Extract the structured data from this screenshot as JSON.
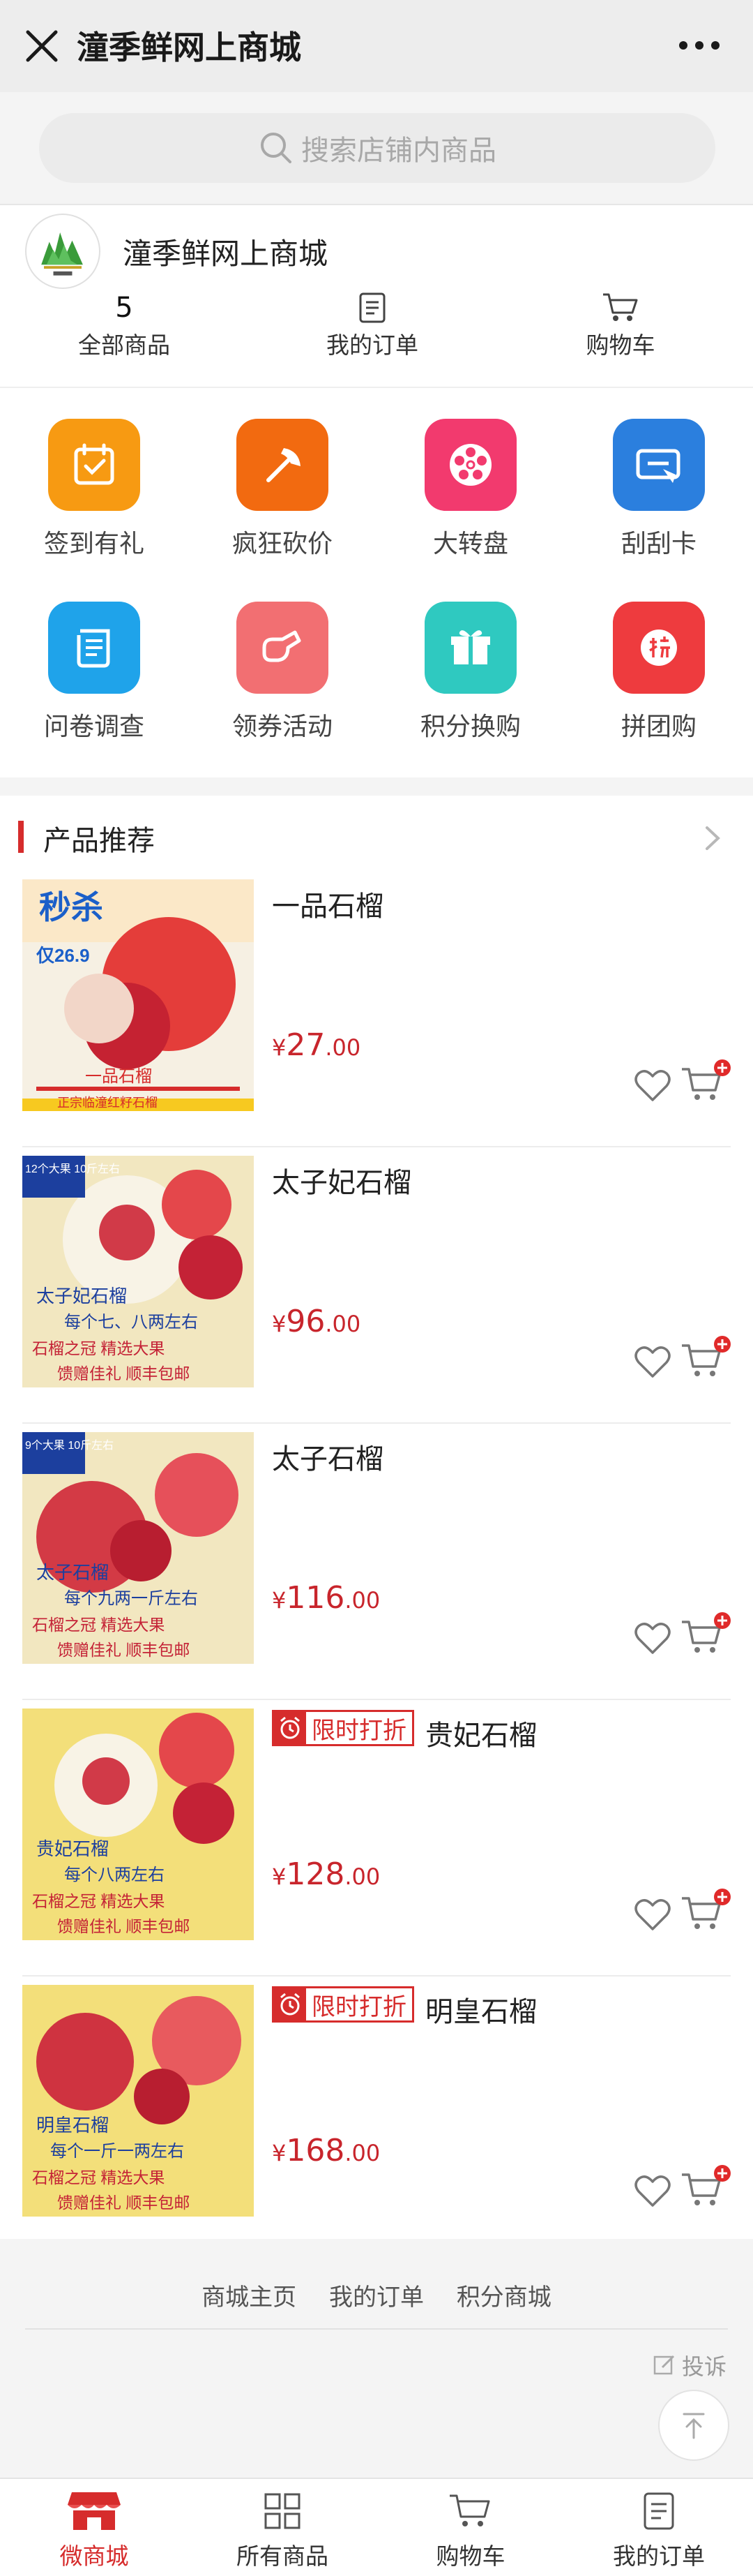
{
  "window": {
    "title": "潼季鲜网上商城",
    "close_icon": "close-icon",
    "more_icon": "more-icon"
  },
  "search": {
    "placeholder": "搜索店铺内商品"
  },
  "shop": {
    "name": "潼季鲜网上商城",
    "stats": [
      {
        "value": "5",
        "label": "全部商品"
      },
      {
        "icon": "order-icon",
        "label": "我的订单"
      },
      {
        "icon": "cart-icon",
        "label": "购物车"
      }
    ]
  },
  "menu": {
    "items": [
      {
        "label": "签到有礼",
        "icon": "calendar-check-icon",
        "color": "#f79a12"
      },
      {
        "label": "疯狂砍价",
        "icon": "axe-icon",
        "color": "#f26a10"
      },
      {
        "label": "大转盘",
        "icon": "wheel-icon",
        "color": "#f23a6e"
      },
      {
        "label": "刮刮卡",
        "icon": "scratch-card-icon",
        "color": "#2b7fde"
      },
      {
        "label": "问卷调查",
        "icon": "scroll-icon",
        "color": "#1fa3ea"
      },
      {
        "label": "领券活动",
        "icon": "coupon-hand-icon",
        "color": "#f26f72"
      },
      {
        "label": "积分换购",
        "icon": "gift-icon",
        "color": "#2fc9c0"
      },
      {
        "label": "拼团购",
        "icon": "group-buy-icon",
        "color": "#ee3b3e"
      }
    ]
  },
  "products": {
    "section_title": "产品推荐",
    "items": [
      {
        "name": "一品石榴",
        "currency": "¥",
        "price_int": "27",
        "price_dec": ".00",
        "tag": ""
      },
      {
        "name": "太子妃石榴",
        "currency": "¥",
        "price_int": "96",
        "price_dec": ".00",
        "tag": ""
      },
      {
        "name": "太子石榴",
        "currency": "¥",
        "price_int": "116",
        "price_dec": ".00",
        "tag": ""
      },
      {
        "name": "贵妃石榴",
        "currency": "¥",
        "price_int": "128",
        "price_dec": ".00",
        "tag": "限时打折"
      },
      {
        "name": "明皇石榴",
        "currency": "¥",
        "price_int": "168",
        "price_dec": ".00",
        "tag": "限时打折"
      }
    ],
    "image_texts": [
      {
        "top": "秒杀",
        "badge": "仅26.9",
        "line1": "一品石榴",
        "line2": "正宗临潼红籽石榴"
      },
      {
        "top": "12个大果 10斤左右",
        "line1": "太子妃石榴",
        "line2": "每个七、八两左右",
        "line3": "石榴之冠 精选大果",
        "line4": "馈赠佳礼 顺丰包邮"
      },
      {
        "top": "9个大果 10斤左右",
        "line1": "太子石榴",
        "line2": "每个九两一斤左右",
        "line3": "石榴之冠 精选大果",
        "line4": "馈赠佳礼 顺丰包邮"
      },
      {
        "line1": "贵妃石榴",
        "line2": "每个八两左右",
        "line3": "石榴之冠 精选大果",
        "line4": "馈赠佳礼 顺丰包邮"
      },
      {
        "line1": "明皇石榴",
        "line2": "每个一斤一两左右",
        "line3": "石榴之冠 精选大果",
        "line4": "馈赠佳礼 顺丰包邮"
      }
    ]
  },
  "footer": {
    "links": [
      "商城主页",
      "我的订单",
      "积分商城"
    ],
    "complain": "投诉"
  },
  "tabbar": {
    "items": [
      {
        "label": "微商城",
        "icon": "shop-icon",
        "active": true
      },
      {
        "label": "所有商品",
        "icon": "grid-icon",
        "active": false
      },
      {
        "label": "购物车",
        "icon": "cart-icon",
        "active": false
      },
      {
        "label": "我的订单",
        "icon": "order-icon",
        "active": false
      }
    ]
  },
  "colors": {
    "accent": "#d62c2c",
    "price": "#c8252c"
  }
}
